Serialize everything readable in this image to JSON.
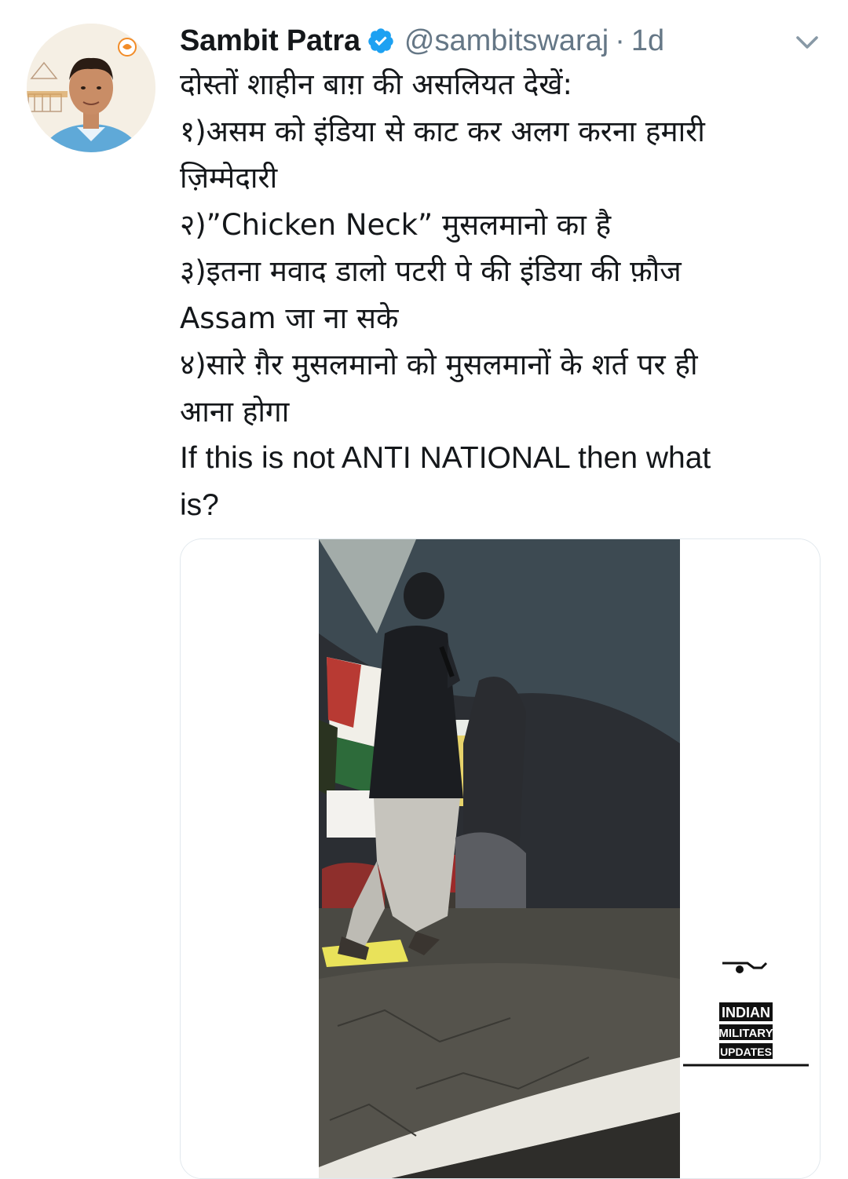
{
  "author": {
    "name": "Sambit Patra",
    "handle": "@sambitswaraj",
    "separator": "·",
    "time": "1d",
    "verified": true
  },
  "tweet": {
    "lines": [
      "दोस्तों शाहीन बाग़ की असलियत देखें:",
      "१)असम को इंडिया से काट कर अलग करना हमारी",
      "ज़िम्मेदारी",
      "२)”Chicken Neck” मुसलमानो का है",
      "३)इतना मवाद डालो पटरी पे की इंडिया की फ़ौज",
      "Assam जा ना सके",
      "४)सारे ग़ैर मुसलमानो को मुसलमानों के शर्त पर ही",
      "आना होगा",
      "If this is not ANTI NATIONAL then what",
      "is?"
    ]
  },
  "media": {
    "watermark": [
      "INDIAN",
      "MILITARY",
      "UPDATES"
    ]
  },
  "icons": {
    "verified": "verified-badge-icon",
    "menu": "chevron-down-icon"
  },
  "colors": {
    "verified": "#1da1f2",
    "secondary_text": "#657786",
    "primary_text": "#14171a"
  }
}
